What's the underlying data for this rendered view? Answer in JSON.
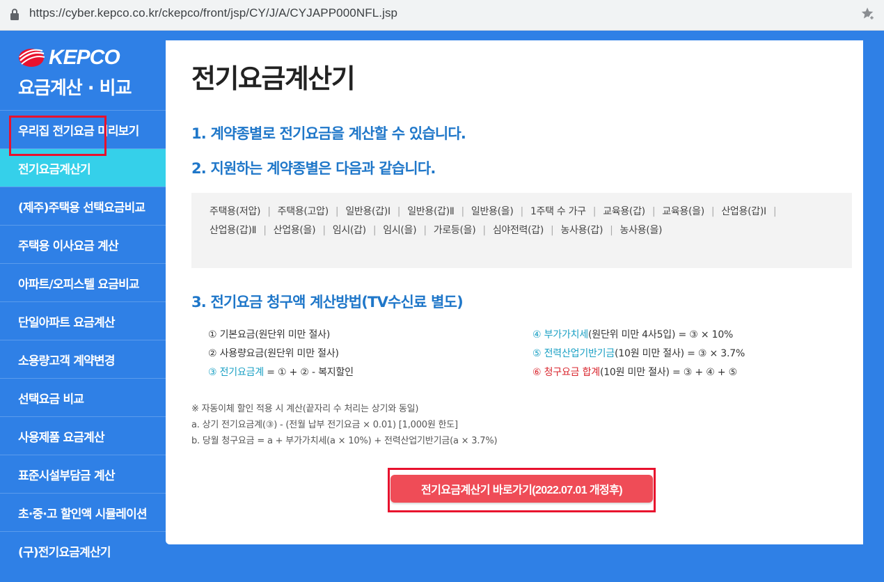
{
  "browser": {
    "url": "https://cyber.kepco.co.kr/ckepco/front/jsp/CY/J/A/CYJAPP000NFL.jsp",
    "lock_icon": "lock-icon",
    "star_icon": "bookmark-star-icon"
  },
  "sidebar": {
    "logo_word": "KEPCO",
    "logo_sub": "요금계산 · 비교",
    "items": [
      {
        "label": "우리집 전기요금 미리보기"
      },
      {
        "label": "전기요금계산기",
        "active": true
      },
      {
        "label": "(제주)주택용 선택요금비교"
      },
      {
        "label": "주택용 이사요금 계산"
      },
      {
        "label": "아파트/오피스텔 요금비교"
      },
      {
        "label": "단일아파트 요금계산"
      },
      {
        "label": "소용량고객 계약변경"
      },
      {
        "label": "선택요금 비교"
      },
      {
        "label": "사용제품 요금계산"
      },
      {
        "label": "표준시설부담금 계산"
      },
      {
        "label": "초·중·고 할인액 시뮬레이션"
      },
      {
        "label": "(구)전기요금계산기"
      }
    ]
  },
  "main": {
    "title": "전기요금계산기",
    "h1": "1. 계약종별로 전기요금을 계산할 수 있습니다.",
    "h2": "2. 지원하는 계약종별은 다음과 같습니다.",
    "contract_types": [
      "주택용(저압)",
      "주택용(고압)",
      "일반용(갑)Ⅰ",
      "일반용(갑)Ⅱ",
      "일반용(을)",
      "1주택 수 가구",
      "교육용(갑)",
      "교육용(을)",
      "산업용(갑)Ⅰ",
      "산업용(갑)Ⅱ",
      "산업용(을)",
      "임시(갑)",
      "임시(을)",
      "가로등(을)",
      "심야전력(갑)",
      "농사용(갑)",
      "농사용(을)"
    ],
    "h3": "3. 전기요금 청구액 계산방법(TV수신료 별도)",
    "calc_left": {
      "l1": "① 기본요금(원단위 미만 절사)",
      "l2": "② 사용량요금(원단위 미만 절사)",
      "l3_colored": "③ 전기요금계",
      "l3_rest": " = ① + ② - 복지할인"
    },
    "calc_right": {
      "r1_colored": "④ 부가가치세",
      "r1_rest": "(원단위 미만 4사5입) = ③ × 10%",
      "r2_colored": "⑤ 전력산업기반기금",
      "r2_rest": "(10원 미만 절사) = ③ × 3.7%",
      "r3_colored": "⑥ 청구요금 합계",
      "r3_rest": "(10원 미만 절사) = ③ + ④ + ⑤"
    },
    "notes": {
      "n1": "※ 자동이체 할인 적용 시 계산(끝자리 수 처리는 상기와 동일)",
      "n2": "a. 상기 전기요금계(③) - (전월 납부 전기요금 × 0.01) [1,000원 한도]",
      "n3": "b. 당월 청구요금 = a + 부가가치세(a × 10%) + 전력산업기반기금(a × 3.7%)"
    },
    "button_label": "전기요금계산기 바로가기(2022.07.01 개정후)"
  }
}
